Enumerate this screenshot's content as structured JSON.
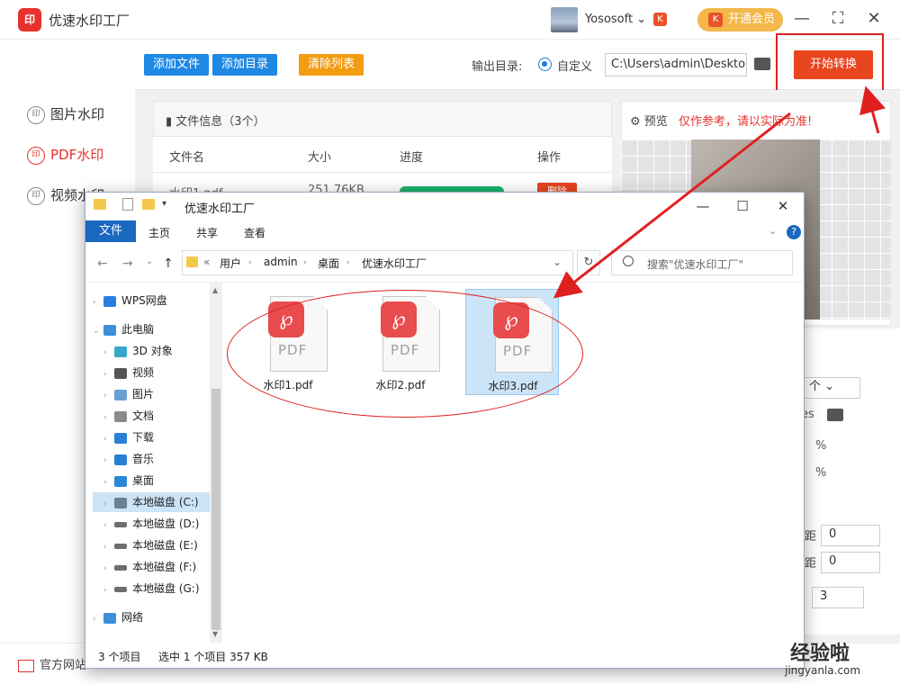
{
  "app": {
    "logo_text": "印",
    "title": "优速水印工厂",
    "username": "Yososoft",
    "vip_button": "开通会员",
    "vip_icon": "K"
  },
  "sidebar": {
    "items": [
      {
        "label": "图片水印",
        "icon": "印"
      },
      {
        "label": "PDF水印",
        "icon": "印",
        "active": true
      },
      {
        "label": "视频水印",
        "icon": "印"
      }
    ]
  },
  "toolbar": {
    "add_file": "添加文件",
    "add_dir": "添加目录",
    "clear_list": "清除列表",
    "output_label": "输出目录:",
    "radio_label": "自定义",
    "output_path": "C:\\Users\\admin\\Deskto",
    "start": "开始转换"
  },
  "file_table": {
    "title": "文件信息（3个）",
    "headers": [
      "文件名",
      "大小",
      "进度",
      "操作"
    ],
    "row": {
      "name": "水印1.pdf",
      "size": "251.76KB",
      "progress": 1.0,
      "action": "删除"
    }
  },
  "preview": {
    "label": "预览",
    "warning": "仅作参考，请以实际为准!"
  },
  "settings": {
    "select_value": "个",
    "path_fragment": "es",
    "unit1": "%",
    "unit2": "%",
    "label_ju1": "距",
    "label_ju2": "距",
    "value1": "0",
    "value2": "0",
    "value3": "3"
  },
  "bottom": {
    "official_site": "官方网站"
  },
  "explorer": {
    "title": "优速水印工厂",
    "menu_file": "文件",
    "menu_tabs": [
      "主页",
      "共享",
      "查看"
    ],
    "breadcrumb": [
      "用户",
      "admin",
      "桌面",
      "优速水印工厂"
    ],
    "search_placeholder": "搜索\"优速水印工厂\"",
    "tree": [
      {
        "label": "WPS网盘",
        "color": "#2b7de0"
      },
      {
        "label": "此电脑",
        "color": "#3d8fd8"
      },
      {
        "label": "3D 对象",
        "color": "#36a7c9"
      },
      {
        "label": "视频",
        "color": "#555"
      },
      {
        "label": "图片",
        "color": "#6a9fd0"
      },
      {
        "label": "文档",
        "color": "#8a8a8a"
      },
      {
        "label": "下载",
        "color": "#2a7fd4"
      },
      {
        "label": "音乐",
        "color": "#2a7fd4"
      },
      {
        "label": "桌面",
        "color": "#2a86d8"
      },
      {
        "label": "本地磁盘 (C:)",
        "color": "#6d7f95",
        "selected": true
      },
      {
        "label": "本地磁盘 (D:)",
        "color": "#6d6d6d"
      },
      {
        "label": "本地磁盘 (E:)",
        "color": "#6d6d6d"
      },
      {
        "label": "本地磁盘 (F:)",
        "color": "#6d6d6d"
      },
      {
        "label": "本地磁盘 (G:)",
        "color": "#6d6d6d"
      },
      {
        "label": "网络",
        "color": "#3d8fd8"
      }
    ],
    "files": [
      {
        "name": "水印1.pdf",
        "type_label": "PDF"
      },
      {
        "name": "水印2.pdf",
        "type_label": "PDF"
      },
      {
        "name": "水印3.pdf",
        "type_label": "PDF",
        "selected": true
      }
    ],
    "status_count": "3 个项目",
    "status_selected": "选中 1 个项目  357 KB"
  },
  "watermark": {
    "text": "经验啦",
    "url": "jingyanla.com"
  },
  "colors": {
    "accent_red": "#e6322d",
    "start_button": "#e8441e",
    "blue_button": "#1e88e5",
    "orange_button": "#f39c12",
    "explorer_blue": "#1a68c0"
  }
}
